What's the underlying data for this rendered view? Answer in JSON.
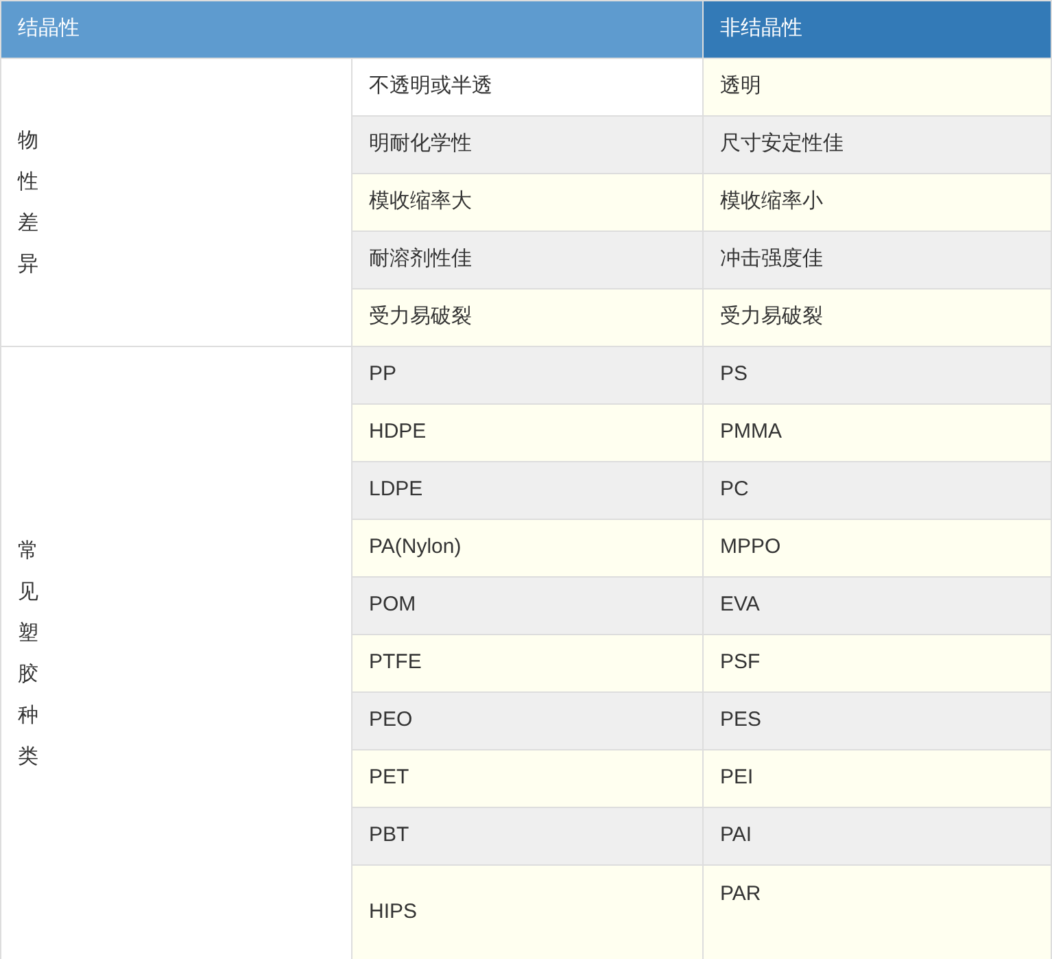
{
  "table": {
    "columns": [
      {
        "label": "结晶性"
      },
      {
        "label": "非结晶性"
      }
    ],
    "groups": [
      {
        "label": "物性差异",
        "rows": [
          {
            "cells": [
              {
                "text": "不透明或半透"
              },
              {
                "text": "透明"
              }
            ]
          },
          {
            "cells": [
              {
                "text": "明耐化学性"
              },
              {
                "text": "尺寸安定性佳"
              }
            ]
          },
          {
            "cells": [
              {
                "text": "模收缩率大"
              },
              {
                "text": "模收缩率小"
              }
            ]
          },
          {
            "cells": [
              {
                "text": "耐溶剂性佳"
              },
              {
                "text": "冲击强度佳"
              }
            ]
          },
          {
            "cells": [
              {
                "text": "受力易破裂"
              },
              {
                "text": "受力易破裂"
              }
            ]
          }
        ]
      },
      {
        "label": "常见塑胶种类",
        "rows": [
          {
            "cells": [
              {
                "text": "PP"
              },
              {
                "text": "PS"
              }
            ]
          },
          {
            "cells": [
              {
                "text": "HDPE"
              },
              {
                "text": "PMMA"
              }
            ]
          },
          {
            "cells": [
              {
                "text": "LDPE"
              },
              {
                "text": "PC"
              }
            ]
          },
          {
            "cells": [
              {
                "text": "PA(Nylon)"
              },
              {
                "text": "MPPO"
              }
            ]
          },
          {
            "cells": [
              {
                "text": "POM"
              },
              {
                "text": "EVA"
              }
            ]
          },
          {
            "cells": [
              {
                "text": "PTFE"
              },
              {
                "text": "PSF"
              }
            ]
          },
          {
            "cells": [
              {
                "text": "PEO"
              },
              {
                "text": "PES"
              }
            ]
          },
          {
            "cells": [
              {
                "text": "PET"
              },
              {
                "text": "PEI"
              }
            ]
          },
          {
            "cells": [
              {
                "text": "PBT"
              },
              {
                "text": "PAI"
              }
            ]
          },
          {
            "tall": true,
            "cells": [
              {
                "text": "HIPS"
              },
              {
                "text": "PAR",
                "top_aligned": true
              }
            ]
          }
        ]
      }
    ]
  }
}
